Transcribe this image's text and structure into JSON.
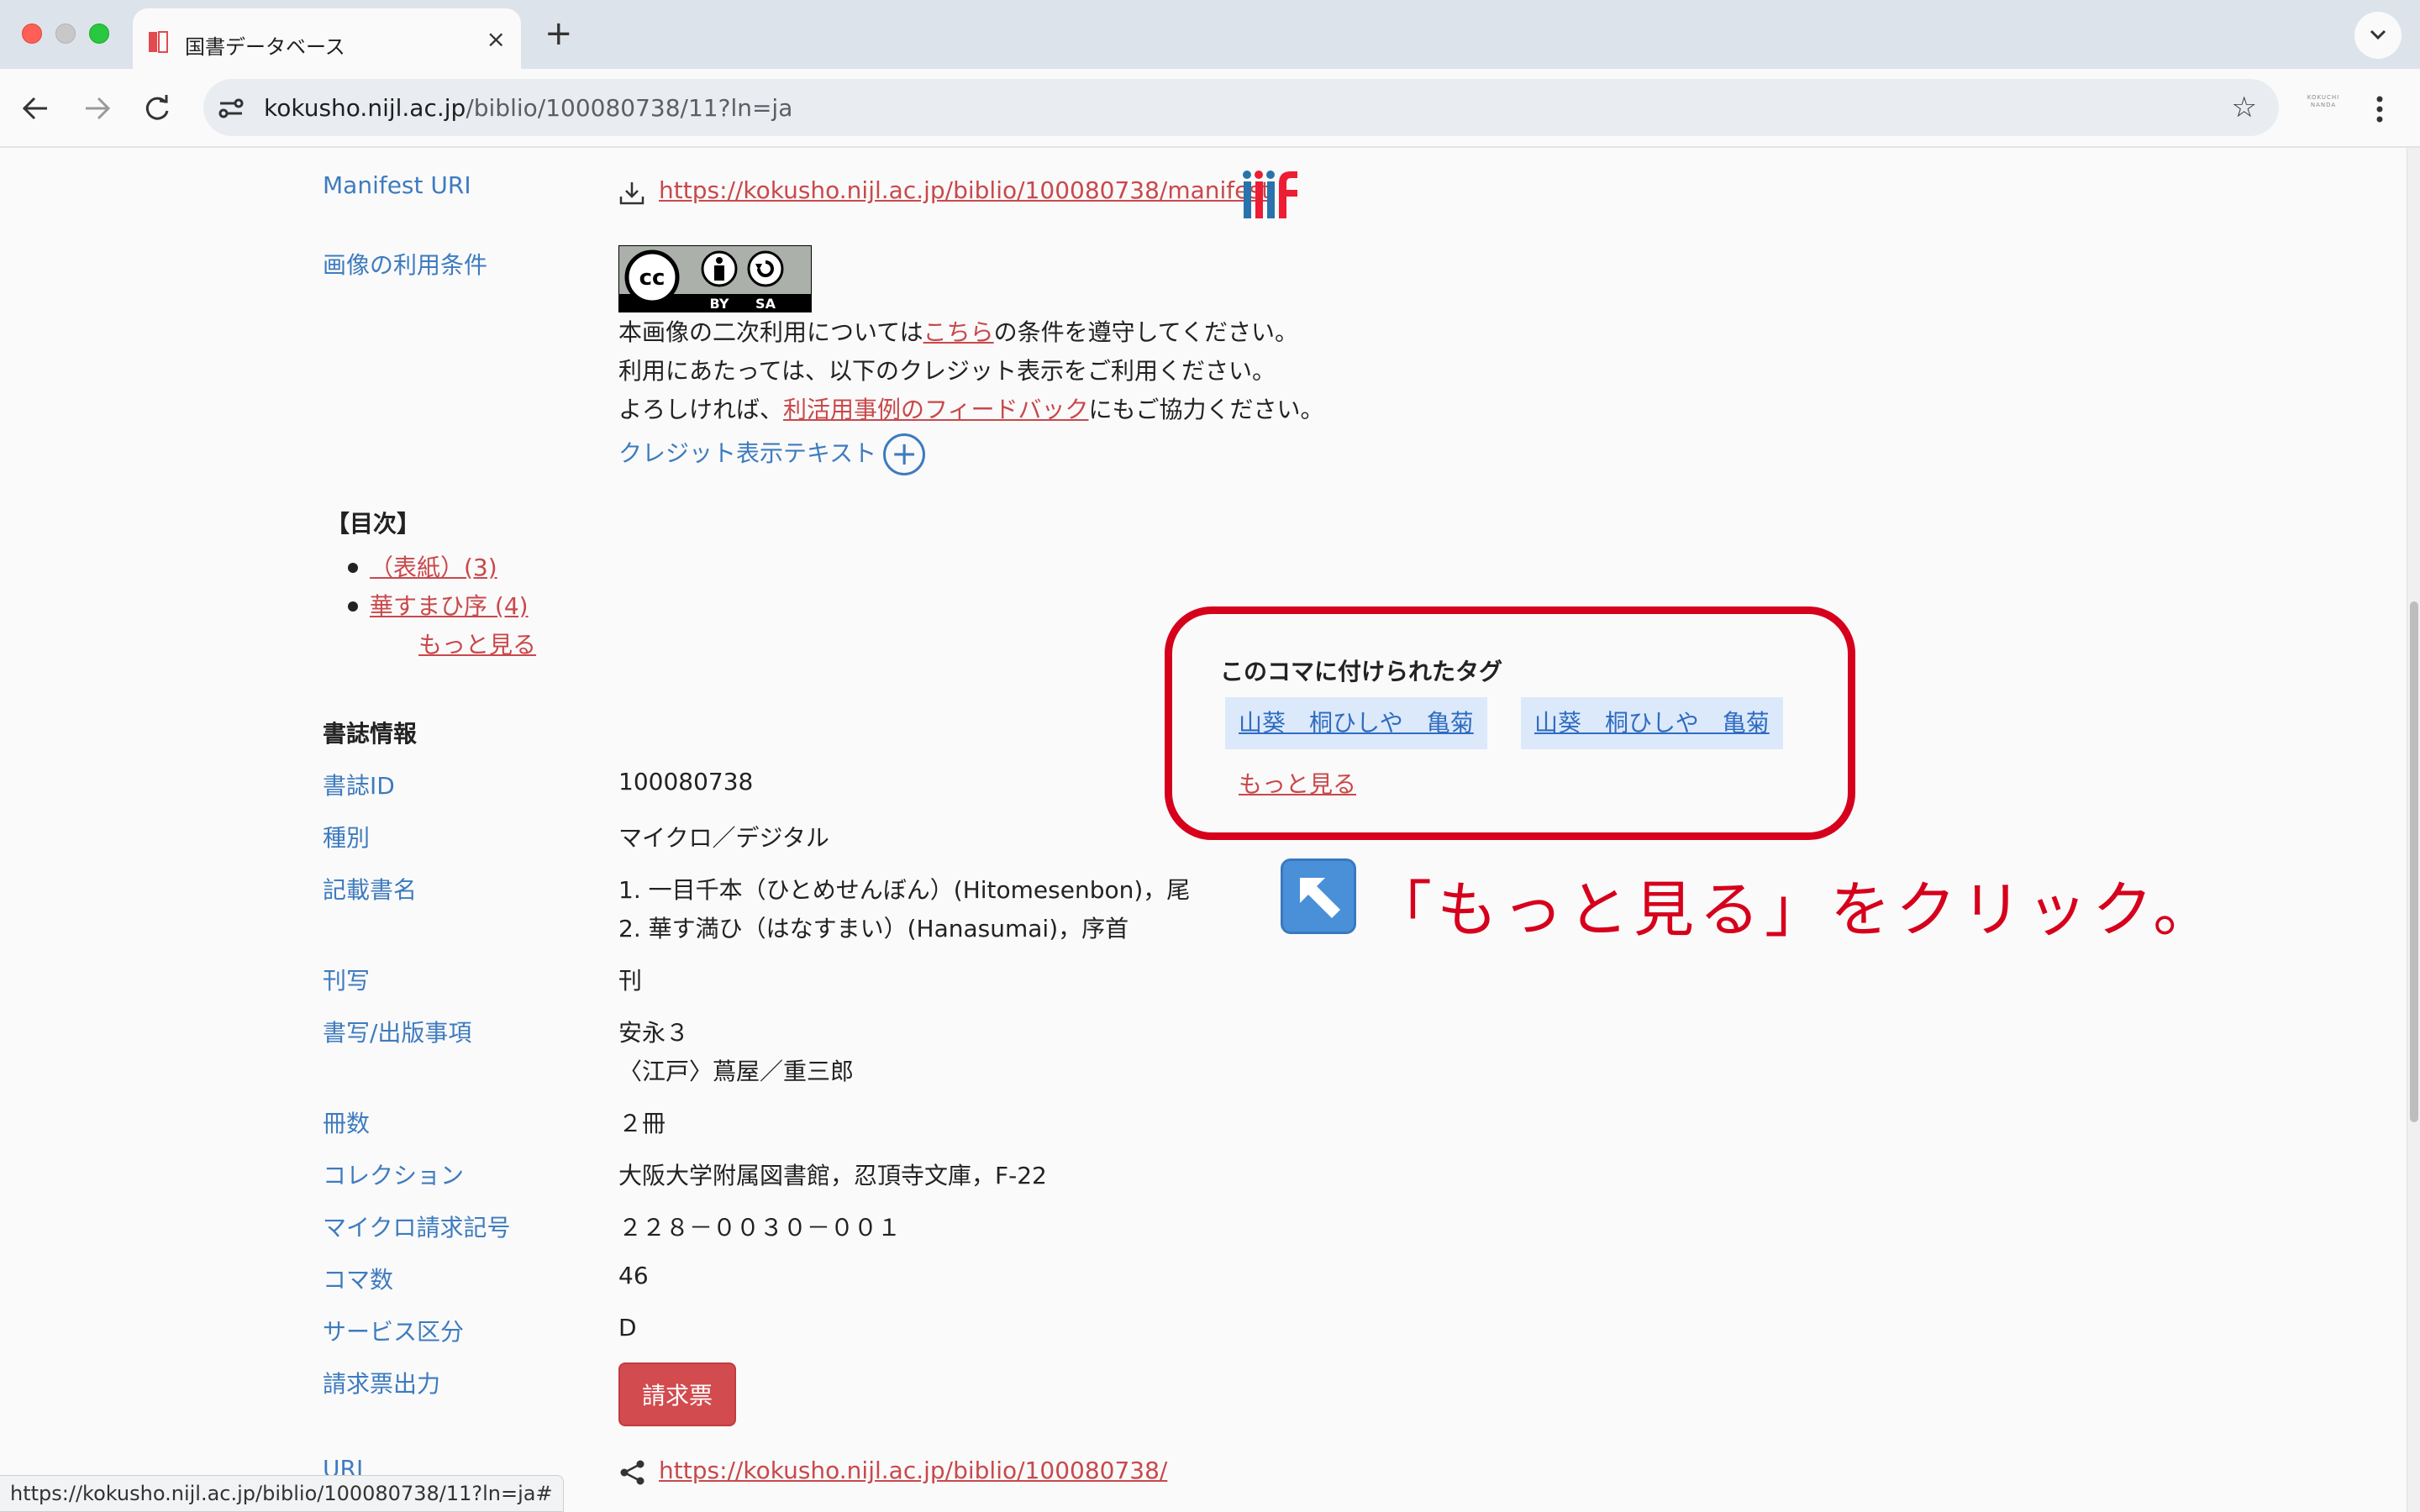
{
  "browser": {
    "tab_title": "国書データベース",
    "tab_close": "×",
    "new_tab": "+",
    "url_host": "kokusho.nijl.ac.jp",
    "url_path": "/biblio/100080738/11?ln=ja",
    "bookmark_star": "☆",
    "profile_text": "KOKUCHI NANDA",
    "status_url": "https://kokusho.nijl.ac.jp/biblio/100080738/11?ln=ja#"
  },
  "record": {
    "manifest_label": "Manifest URI",
    "manifest_url": "https://kokusho.nijl.ac.jp/biblio/100080738/manifest",
    "usage_label": "画像の利用条件",
    "license_badge": {
      "cc": "cc",
      "by": "BY",
      "sa": "SA"
    },
    "usage_line1_pre": "本画像の二次利用については",
    "usage_line1_link": "こちら",
    "usage_line1_post": "の条件を遵守してください。",
    "usage_line2": "利用にあたっては、以下のクレジット表示をご利用ください。",
    "usage_line3_pre": "よろしければ、",
    "usage_line3_link": "利活用事例のフィードバック",
    "usage_line3_post": "にもご協力ください。",
    "credit_text": "クレジット表示テキスト",
    "credit_plus": "+"
  },
  "toc": {
    "heading": "【目次】",
    "items": [
      {
        "label": "（表紙）(3)"
      },
      {
        "label": "華すまひ序 (4)"
      }
    ],
    "more": "もっと見る"
  },
  "tags": {
    "heading": "このコマに付けられたタグ",
    "items": [
      "山葵　桐ひしや　亀菊",
      "山葵　桐ひしや　亀菊"
    ],
    "more": "もっと見る"
  },
  "instruction": {
    "emoji": "↖",
    "text": "「もっと見る」をクリック。"
  },
  "biblio": {
    "heading": "書誌情報",
    "rows": [
      {
        "label": "書誌ID",
        "value": "100080738"
      },
      {
        "label": "種別",
        "value": "マイクロ／デジタル"
      },
      {
        "label": "記載書名",
        "values": [
          "1.  一目千本（ひとめせんぼん）(Hitomesenbon)，尾",
          "2.  華す満ひ（はなすまい）(Hanasumai)，序首"
        ]
      },
      {
        "label": "刊写",
        "value": "刊"
      },
      {
        "label": "書写/出版事項",
        "values": [
          "安永３",
          "〈江戸〉蔦屋／重三郎"
        ]
      },
      {
        "label": "冊数",
        "value": "２冊"
      },
      {
        "label": "コレクション",
        "value": "大阪大学附属図書館，忍頂寺文庫，F-22"
      },
      {
        "label": "マイクロ請求記号",
        "value": "２２８－００３０－００１"
      },
      {
        "label": "コマ数",
        "value": "46"
      },
      {
        "label": "サービス区分",
        "value": "D"
      },
      {
        "label": "請求票出力",
        "button": "請求票"
      },
      {
        "label": "URI",
        "link": "https://kokusho.nijl.ac.jp/biblio/100080738/"
      }
    ]
  },
  "colors": {
    "accent_link": "#c9484b",
    "label_blue": "#3e7bbf",
    "annotation_red": "#d6001c",
    "button_red": "#d24b4e"
  }
}
